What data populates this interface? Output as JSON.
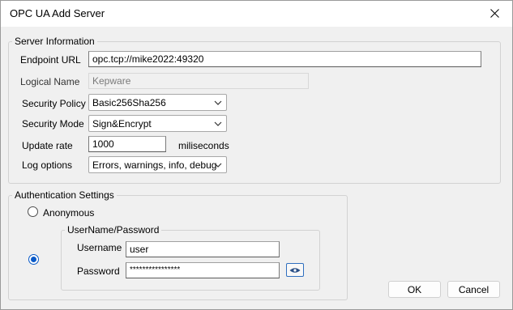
{
  "window": {
    "title": "OPC UA Add Server"
  },
  "server_info": {
    "legend": "Server Information",
    "endpoint_label": "Endpoint URL",
    "endpoint_value": "opc.tcp://mike2022:49320",
    "logical_name_label": "Logical Name",
    "logical_name_placeholder": "Kepware",
    "security_policy_label": "Security Policy",
    "security_policy_value": "Basic256Sha256",
    "security_mode_label": "Security Mode",
    "security_mode_value": "Sign&Encrypt",
    "update_rate_label": "Update rate",
    "update_rate_value": "1000",
    "update_rate_unit": "miliseconds",
    "log_options_label": "Log options",
    "log_options_value": "Errors, warnings, info, debug"
  },
  "auth": {
    "legend": "Authentication Settings",
    "anonymous_label": "Anonymous",
    "anonymous_selected": false,
    "userpass_selected": true,
    "userpass_legend": "UserName/Password",
    "username_label": "Username",
    "username_value": "user",
    "password_label": "Password",
    "password_masked": "****************"
  },
  "buttons": {
    "ok_label": "OK",
    "cancel_label": "Cancel"
  },
  "icons": {
    "close": "close-icon",
    "chevron": "chevron-down-icon",
    "eye": "eye-icon"
  },
  "colors": {
    "accent": "#0a5ac8",
    "window_bg": "#f0f0f0"
  }
}
